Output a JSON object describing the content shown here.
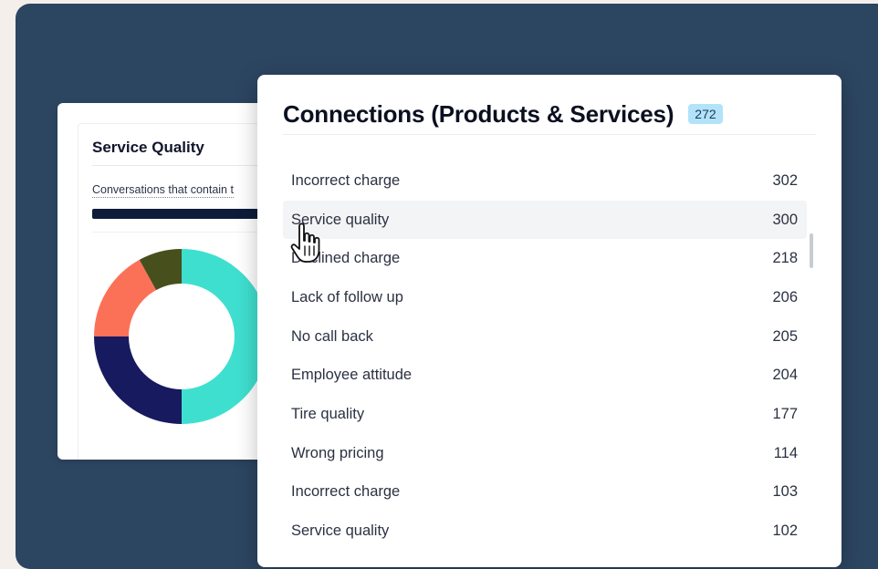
{
  "back_card": {
    "title": "Service Quality",
    "subtitle": "Conversations that contain t"
  },
  "donut_chart": {
    "type": "pie",
    "slices": [
      {
        "value": 50,
        "color": "#3fdfd0"
      },
      {
        "value": 25,
        "color": "#171a5f"
      },
      {
        "value": 17,
        "color": "#fb7158"
      },
      {
        "value": 8,
        "color": "#47501c"
      }
    ]
  },
  "front_card": {
    "title": "Connections (Products & Services)",
    "badge": "272",
    "rows": [
      {
        "label": "Incorrect charge",
        "value": "302"
      },
      {
        "label": "Service quality",
        "value": "300"
      },
      {
        "label": "Declined charge",
        "value": "218"
      },
      {
        "label": "Lack of follow up",
        "value": "206"
      },
      {
        "label": "No call back",
        "value": "205"
      },
      {
        "label": "Employee attitude",
        "value": "204"
      },
      {
        "label": "Tire quality",
        "value": "177"
      },
      {
        "label": "Wrong pricing",
        "value": "114"
      },
      {
        "label": "Incorrect charge",
        "value": "103"
      },
      {
        "label": "Service quality",
        "value": "102"
      }
    ]
  },
  "colors": {
    "background": "#2c4561",
    "badge": "#b3e2fb",
    "hover_row": "#f3f4f5"
  },
  "icons": {
    "cursor": "hand-pointer-icon"
  }
}
